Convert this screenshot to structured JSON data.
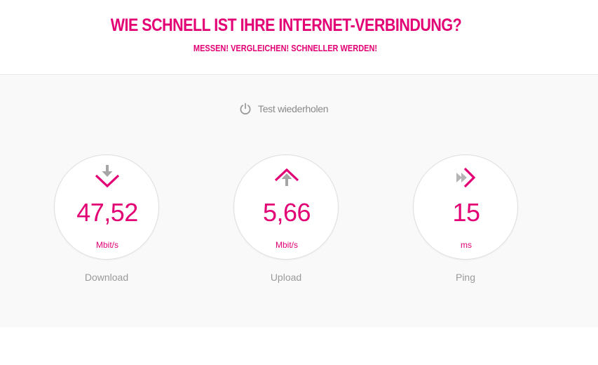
{
  "header": {
    "title": "WIE SCHNELL IST IHRE INTERNET-VERBINDUNG?",
    "subtitle": "MESSEN! VERGLEICHEN! SCHNELLER WERDEN!"
  },
  "actions": {
    "repeat_label": "Test wiederholen",
    "repeat_icon": "power-icon"
  },
  "colors": {
    "accent": "#e20074",
    "muted_text": "#9a9a9a",
    "icon_gray": "#a6a6a6"
  },
  "metrics": [
    {
      "label": "Download",
      "value": "47,52",
      "unit": "Mbit/s",
      "icon": "download-icon"
    },
    {
      "label": "Upload",
      "value": "5,66",
      "unit": "Mbit/s",
      "icon": "upload-icon"
    },
    {
      "label": "Ping",
      "value": "15",
      "unit": "ms",
      "icon": "ping-icon"
    }
  ]
}
